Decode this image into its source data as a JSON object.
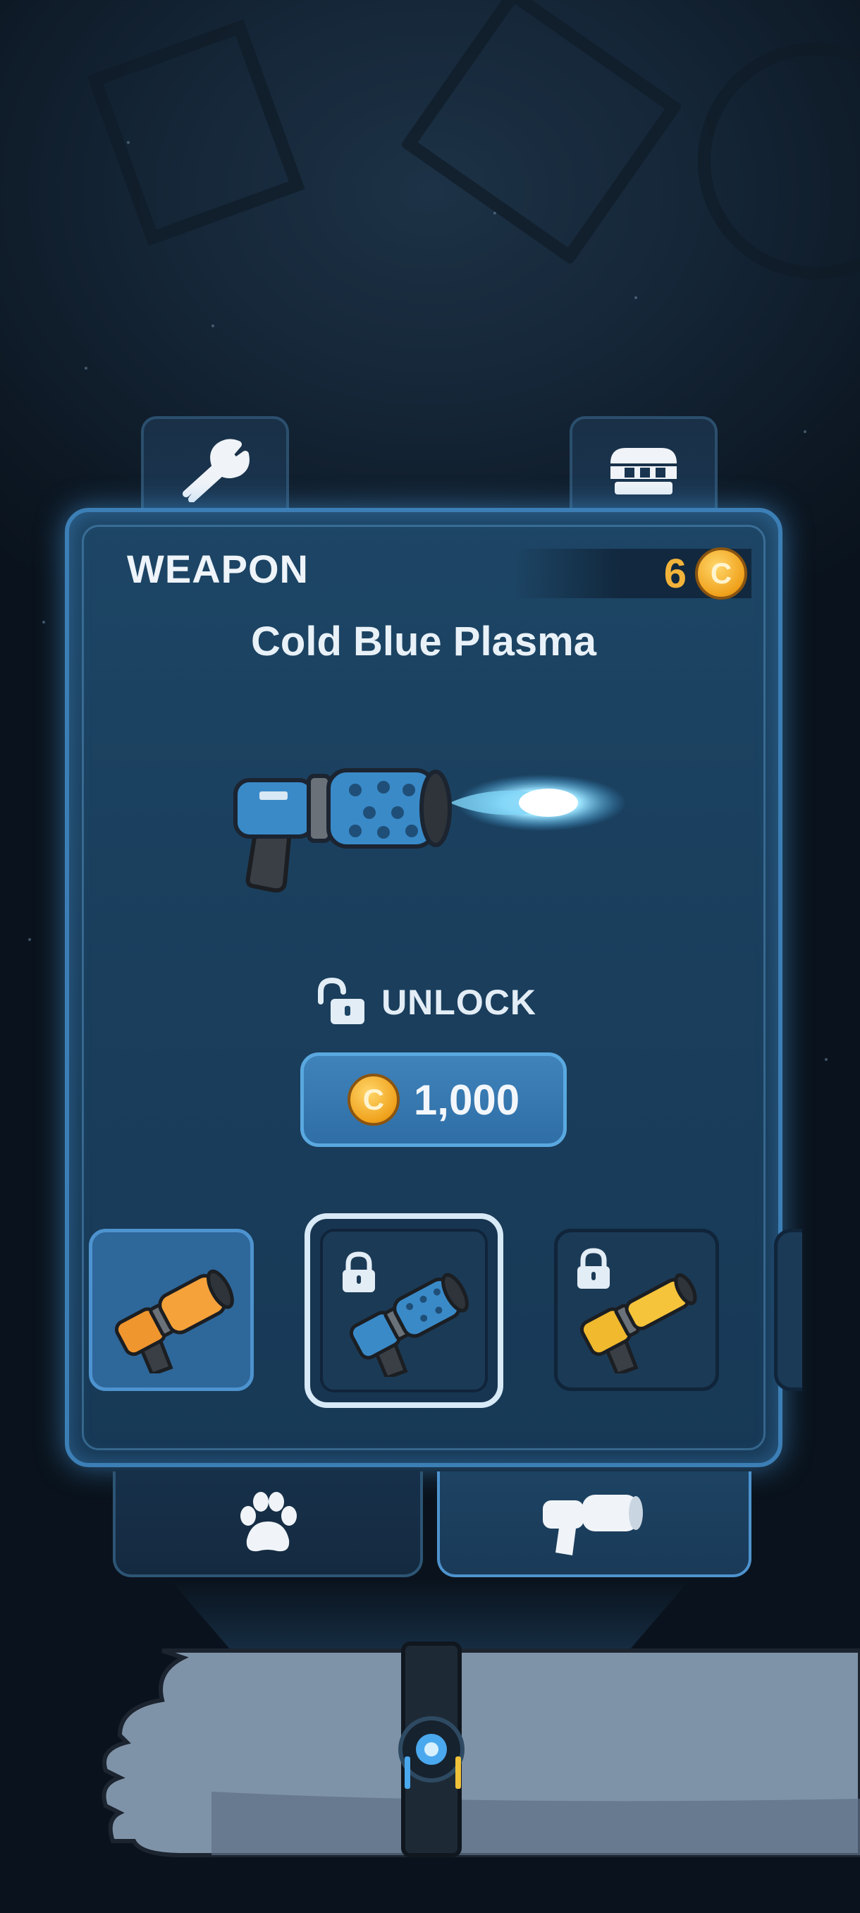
{
  "colors": {
    "panel_border": "#3c7fb6",
    "coin_gold": "#f0a21c",
    "text_light": "#eef4fa"
  },
  "top_tabs": [
    {
      "icon": "wrench-icon"
    },
    {
      "icon": "shop-awning-icon"
    }
  ],
  "panel": {
    "category": "WEAPON",
    "coins": "6",
    "coin_symbol": "C",
    "item_name": "Cold Blue Plasma",
    "unlock_label": "UNLOCK",
    "price": "1,000"
  },
  "slots": [
    {
      "weapon": "orange-blaster-icon",
      "locked": false,
      "selected": false
    },
    {
      "weapon": "blue-plasma-blaster-icon",
      "locked": true,
      "selected": true
    },
    {
      "weapon": "yellow-blaster-icon",
      "locked": true,
      "selected": false
    }
  ],
  "bottom_tabs": [
    {
      "icon": "paw-icon"
    },
    {
      "icon": "blaster-icon"
    }
  ]
}
